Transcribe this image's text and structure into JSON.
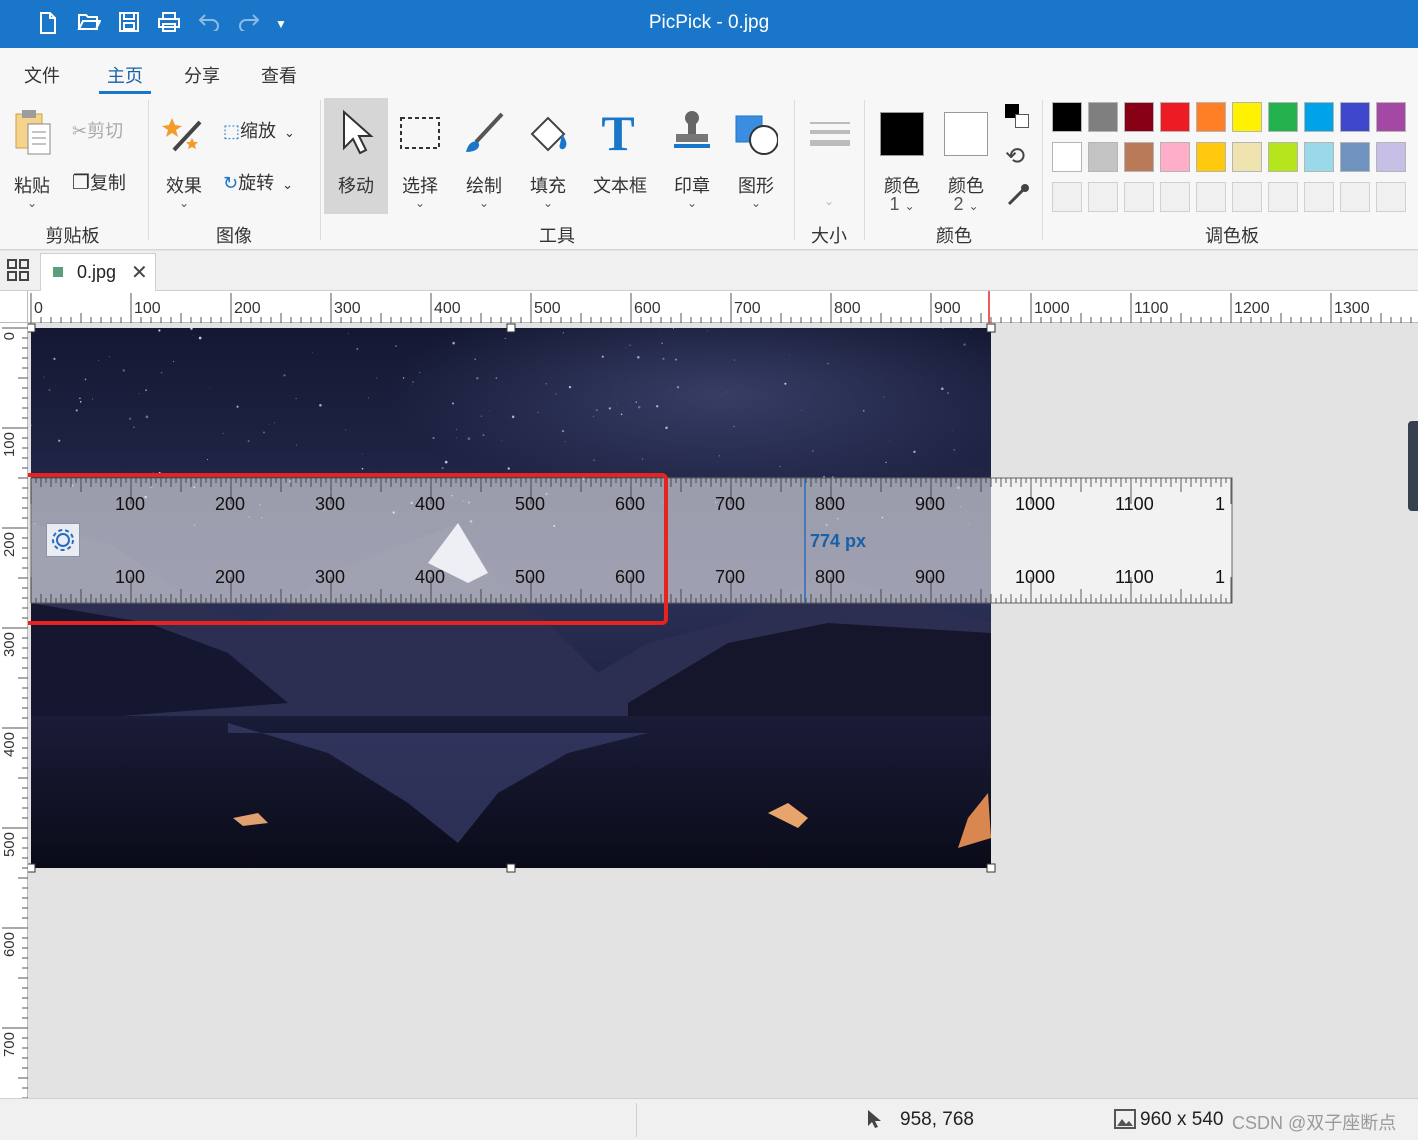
{
  "window": {
    "title": "PicPick - 0.jpg"
  },
  "quick_access": [
    "new-file-icon",
    "open-folder-icon",
    "save-icon",
    "print-icon",
    "undo-icon",
    "redo-icon",
    "customize-dropdown-icon"
  ],
  "menu": {
    "tabs": [
      "文件",
      "主页",
      "分享",
      "查看"
    ],
    "active": "主页"
  },
  "ribbon": {
    "clipboard": {
      "label": "剪贴板",
      "paste": "粘贴",
      "cut": "剪切",
      "copy": "复制"
    },
    "image": {
      "label": "图像",
      "effects": "效果",
      "resize": "缩放",
      "rotate": "旋转"
    },
    "tools": {
      "label": "工具",
      "move": "移动",
      "select": "选择",
      "draw": "绘制",
      "fill": "填充",
      "textbox": "文本框",
      "stamp": "印章",
      "shape": "图形"
    },
    "size": {
      "label": "大小"
    },
    "colors": {
      "label": "颜色",
      "color1": "颜色",
      "color1_num": "1",
      "color2": "颜色",
      "color2_num": "2",
      "color1_value": "#000000",
      "color2_value": "#ffffff"
    },
    "palette": {
      "label": "调色板",
      "row1": [
        "#000000",
        "#7f7f7f",
        "#880015",
        "#ed1c24",
        "#ff7f27",
        "#fff200",
        "#22b14c",
        "#00a2e8",
        "#3f48cc",
        "#a349a4"
      ],
      "row2": [
        "#ffffff",
        "#c3c3c3",
        "#b97a57",
        "#ffaec9",
        "#ffc90e",
        "#efe4b0",
        "#b5e61d",
        "#99d9ea",
        "#7092be",
        "#c8bfe7"
      ],
      "row3_count": 10
    }
  },
  "document_tab": {
    "name": "0.jpg"
  },
  "ruler_h_labels": [
    "0",
    "100",
    "200",
    "300",
    "400",
    "500",
    "600",
    "700",
    "800",
    "900",
    "1000",
    "1100",
    "1200",
    "1300"
  ],
  "ruler_v_labels": [
    "0",
    "100",
    "200",
    "300",
    "400",
    "500",
    "600",
    "700"
  ],
  "pixel_ruler": {
    "labels_top": [
      "100",
      "200",
      "300",
      "400",
      "500",
      "600",
      "700",
      "800",
      "900",
      "1000",
      "1100",
      "1"
    ],
    "labels_bottom": [
      "100",
      "200",
      "300",
      "400",
      "500",
      "600",
      "700",
      "800",
      "900",
      "1000",
      "1100",
      "1"
    ],
    "measure": "774 px"
  },
  "status": {
    "cursor": "958, 768",
    "image_size": "960 x 540",
    "watermark": "CSDN @双子座断点"
  },
  "colors": {
    "titlebar": "#1976c9",
    "highlight_box": "#e8231f",
    "measure_text": "#1a5fa8"
  }
}
